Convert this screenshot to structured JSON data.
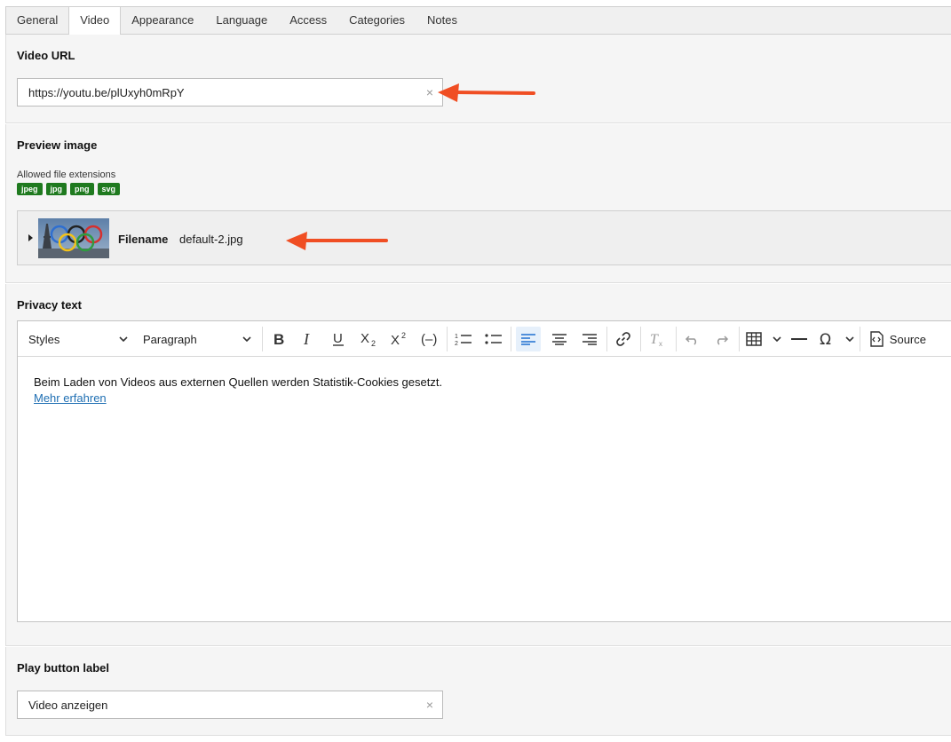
{
  "tabs": [
    "General",
    "Video",
    "Appearance",
    "Language",
    "Access",
    "Categories",
    "Notes"
  ],
  "active_tab": "Video",
  "video_url": {
    "label": "Video URL",
    "value": "https://youtu.be/plUxyh0mRpY",
    "clear": "×"
  },
  "preview": {
    "label": "Preview image",
    "allowed_label": "Allowed file extensions",
    "extensions": [
      "jpeg",
      "jpg",
      "png",
      "svg"
    ],
    "filename_key": "Filename",
    "filename_value": "default-2.jpg"
  },
  "privacy": {
    "label": "Privacy text",
    "styles_dropdown": "Styles",
    "format_dropdown": "Paragraph",
    "source_label": "Source",
    "body_text": "Beim Laden von Videos aus externen Quellen werden Statistik-Cookies gesetzt.",
    "link_text": "Mehr erfahren"
  },
  "play_button": {
    "label": "Play button label",
    "value": "Video anzeigen",
    "clear": "×"
  },
  "colors": {
    "annotation_arrow": "#f04e23",
    "badge_green": "#1f7a1f",
    "link_blue": "#1f6fb3"
  }
}
